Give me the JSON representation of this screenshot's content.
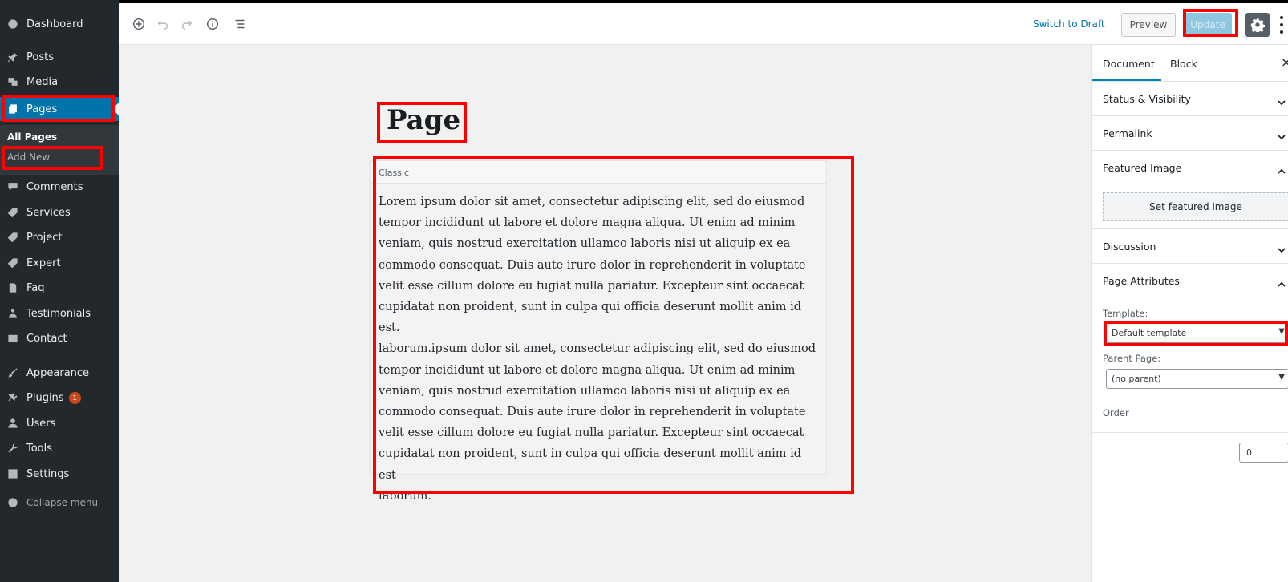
{
  "sidebar": {
    "items": [
      {
        "label": "Dashboard",
        "icon": "dashboard-icon"
      },
      {
        "label": "Posts",
        "icon": "pin-icon"
      },
      {
        "label": "Media",
        "icon": "media-icon"
      },
      {
        "label": "Pages",
        "icon": "pages-icon"
      },
      {
        "label": "Comments",
        "icon": "comment-icon"
      },
      {
        "label": "Services",
        "icon": "tag-icon"
      },
      {
        "label": "Project",
        "icon": "tag-icon"
      },
      {
        "label": "Expert",
        "icon": "tag-icon"
      },
      {
        "label": "Faq",
        "icon": "document-icon"
      },
      {
        "label": "Testimonials",
        "icon": "users-icon"
      },
      {
        "label": "Contact",
        "icon": "envelope-icon"
      },
      {
        "label": "Appearance",
        "icon": "brush-icon"
      },
      {
        "label": "Plugins",
        "icon": "plug-icon"
      },
      {
        "label": "Users",
        "icon": "user-icon"
      },
      {
        "label": "Tools",
        "icon": "wrench-icon"
      },
      {
        "label": "Settings",
        "icon": "settings-icon"
      }
    ],
    "plugins_badge": "1",
    "submenu": {
      "all_pages": "All Pages",
      "add_new": "Add New"
    },
    "collapse": "Collapse menu"
  },
  "toolbar": {
    "switch_draft": "Switch to Draft",
    "preview": "Preview",
    "update": "Update"
  },
  "editor": {
    "title": "Page",
    "block_label": "Classic",
    "content": "Lorem ipsum dolor sit amet, consectetur adipiscing elit, sed do eiusmod\ntempor incididunt ut labore et dolore magna aliqua. Ut enim ad minim\nveniam, quis nostrud exercitation ullamco laboris nisi ut aliquip ex ea\ncommodo consequat. Duis aute irure dolor in reprehenderit in voluptate\nvelit esse cillum dolore eu fugiat nulla pariatur. Excepteur sint occaecat\ncupidatat non proident, sunt in culpa qui officia deserunt mollit anim id est.\nlaborum.ipsum dolor sit amet, consectetur adipiscing elit, sed do eiusmod\ntempor incididunt ut labore et dolore magna aliqua. Ut enim ad minim\nveniam, quis nostrud exercitation ullamco laboris nisi ut aliquip ex ea\ncommodo consequat. Duis aute irure dolor in reprehenderit in voluptate\nvelit esse cillum dolore eu fugiat nulla pariatur. Excepteur sint occaecat\ncupidatat non proident, sunt in culpa qui officia deserunt mollit anim id est\nlaborum."
  },
  "panel": {
    "tabs": [
      "Document",
      "Block"
    ],
    "sections": {
      "status": "Status & Visibility",
      "permalink": "Permalink",
      "featured": "Featured Image",
      "discussion": "Discussion",
      "attributes": "Page Attributes"
    },
    "featured_button": "Set featured image",
    "template_label": "Template:",
    "template_value": "Default template",
    "parent_label": "Parent Page:",
    "parent_value": "(no parent)",
    "order_label": "Order",
    "order_value": "0"
  },
  "colors": {
    "sidebar_bg": "#23282d",
    "active_blue": "#0073aa",
    "highlight": "#ff0000"
  }
}
